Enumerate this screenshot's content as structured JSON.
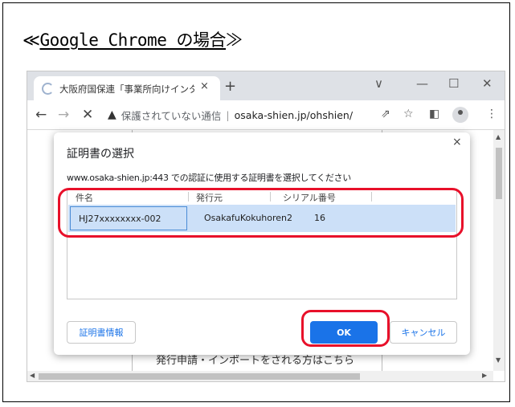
{
  "heading": {
    "symbol_open": "≪",
    "text": "Google Chrome の場合",
    "symbol_close": "≫"
  },
  "browser": {
    "tab_title": "大阪府国保連「事業所向けインター",
    "tab_close": "×",
    "new_tab": "+",
    "window_controls": [
      "∨",
      "—",
      "☐",
      "✕"
    ],
    "security_label": "保護されていない通信",
    "separator": "|",
    "url": "osaka-shien.jp/ohshien/",
    "page_hint": "発行申請・インポートをされる方はこちら"
  },
  "dialog": {
    "title": "証明書の選択",
    "description": "www.osaka-shien.jp:443 での認証に使用する証明書を選択してください",
    "close": "×",
    "columns": [
      "件名",
      "発行元",
      "シリアル番号"
    ],
    "rows": [
      {
        "subject": "HJ27xxxxxxxx-002",
        "issuer": "OsakafuKokuhoren2",
        "serial": "16"
      }
    ],
    "cert_info_button": "証明書情報",
    "ok_button": "OK",
    "cancel_button": "キャンセル"
  },
  "colors": {
    "highlight": "#e8102a",
    "primary": "#1a73e8",
    "selection": "#cce0f8"
  }
}
